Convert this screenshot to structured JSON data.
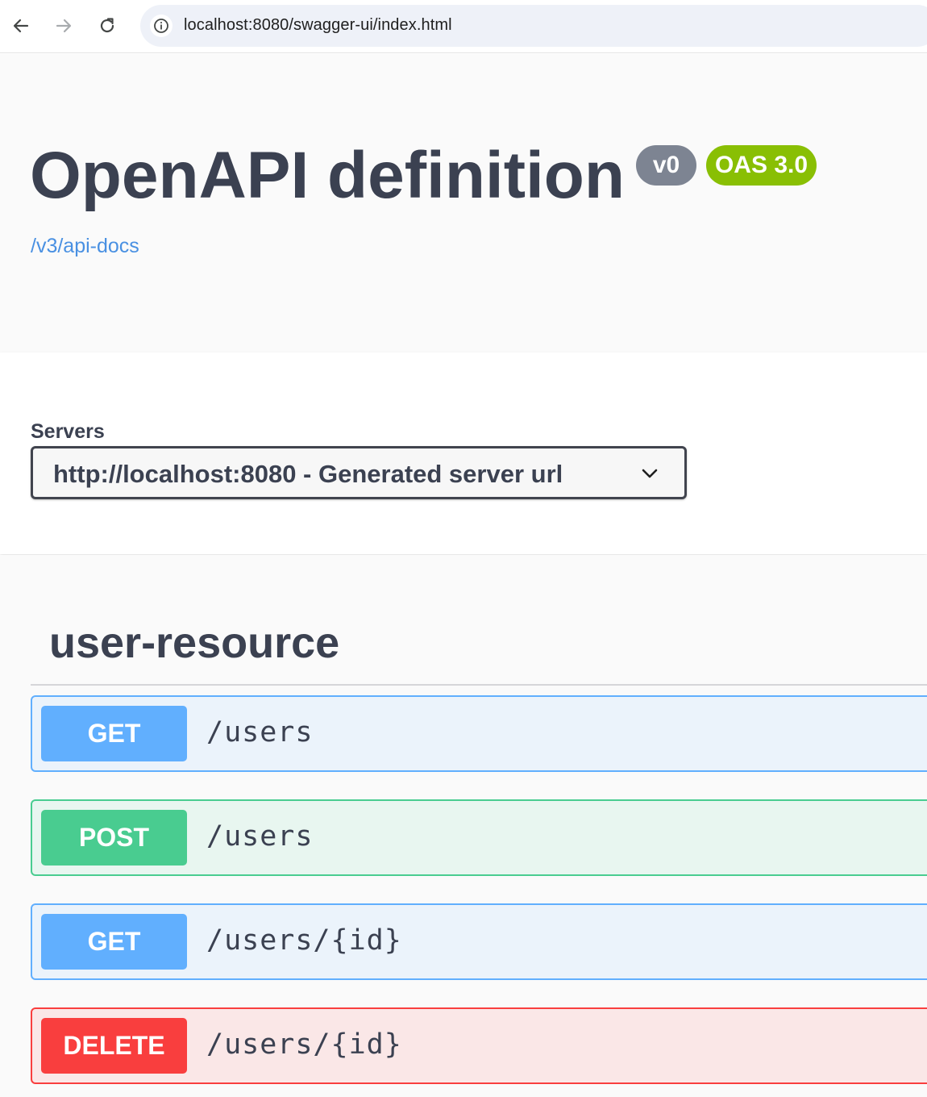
{
  "browser": {
    "url": "localhost:8080/swagger-ui/index.html",
    "back_icon": "arrow-left-icon",
    "forward_icon": "arrow-right-icon",
    "reload_icon": "reload-icon",
    "info_icon": "info-icon"
  },
  "info": {
    "title": "OpenAPI definition",
    "version_badge": "v0",
    "oas_badge": "OAS 3.0",
    "spec_link": "/v3/api-docs"
  },
  "servers": {
    "label": "Servers",
    "selected": "http://localhost:8080 - Generated server url"
  },
  "tags": [
    {
      "name": "user-resource",
      "operations": [
        {
          "method": "GET",
          "path": "/users"
        },
        {
          "method": "POST",
          "path": "/users"
        },
        {
          "method": "GET",
          "path": "/users/{id}"
        },
        {
          "method": "DELETE",
          "path": "/users/{id}"
        }
      ]
    }
  ],
  "colors": {
    "get": "#61affe",
    "post": "#49cc90",
    "delete": "#f93e3e",
    "oas_badge": "#89bf04",
    "version_badge": "#7d8492",
    "link": "#4990e2",
    "text": "#3b4151"
  }
}
